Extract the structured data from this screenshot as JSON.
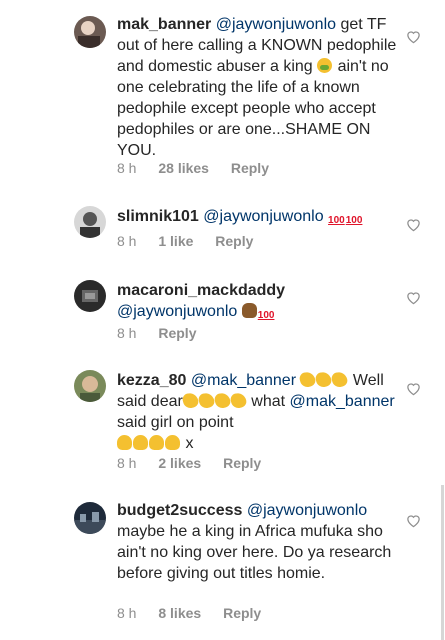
{
  "comments": [
    {
      "username": "mak_banner",
      "mention": "@jaywonjuwonlo",
      "text_a": " get TF out of here calling a KNOWN pedophile and domestic abuser a king ",
      "text_b": " ain't no one celebrating the life of a known pedophile except people who accept pedophiles or are one...SHAME ON YOU.",
      "time": "8 h",
      "likes": "28 likes",
      "reply": "Reply"
    },
    {
      "username": "slimnik101",
      "mention": "@jaywonjuwonlo",
      "time": "8 h",
      "likes": "1 like",
      "reply": "Reply"
    },
    {
      "username": "macaroni_mackdaddy",
      "mention": "@jaywonjuwonlo",
      "time": "8 h",
      "reply": "Reply"
    },
    {
      "username": "kezza_80",
      "mention": "@mak_banner",
      "text_a": " Well said dear",
      "text_b": " what",
      "mention2": "@mak_banner",
      "text_c": " said girl on point",
      "text_d": " x",
      "time": "8 h",
      "likes": "2 likes",
      "reply": "Reply"
    },
    {
      "username": "budget2success",
      "mention": "@jaywonjuwonlo",
      "text_a": " maybe he a king in Africa mufuka sho ain't no king over here.  Do ya research before giving out titles homie.",
      "time": "8 h",
      "likes": "8 likes",
      "reply": "Reply"
    }
  ],
  "icons": {
    "like": "heart-outline-icon",
    "hundred": "hundred-points-emoji",
    "clap": "clapping-hands-emoji",
    "ok": "ok-hand-emoji"
  },
  "colors": {
    "username": "#262626",
    "mention": "#003569",
    "meta": "#8e8e8e"
  }
}
